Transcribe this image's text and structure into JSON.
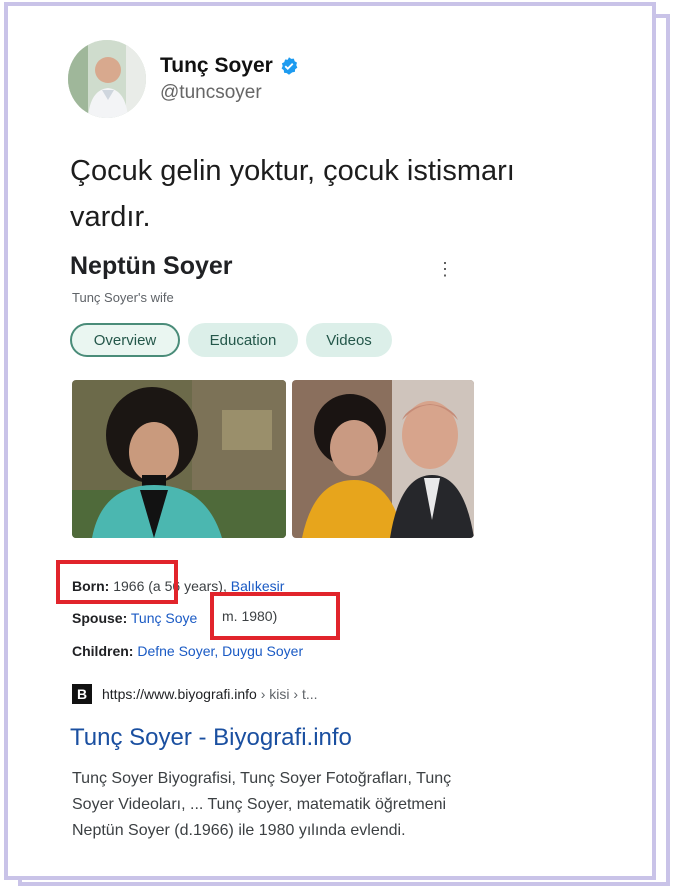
{
  "profile": {
    "name": "Tunç Soyer",
    "handle": "@tuncsoyer",
    "verified_icon": "verified-badge-icon",
    "verified_color": "#1d9bf0"
  },
  "tweet": {
    "line1": "Çocuk gelin yoktur, çocuk istismarı",
    "line2": "vardır."
  },
  "knowledge_panel": {
    "title": "Neptün Soyer",
    "subtitle": "Tunç Soyer's wife",
    "more_icon": "more-vert-icon",
    "tabs": [
      {
        "label": "Overview",
        "active": true
      },
      {
        "label": "Education",
        "active": false
      },
      {
        "label": "Videos",
        "active": false
      }
    ],
    "facts": {
      "born_label": "Born:",
      "born_value": "1966",
      "born_rest": " (a",
      "born_rest2": " 56 years),",
      "born_place": "Balıkesir",
      "spouse_label": "Spouse:",
      "spouse_value": "Tunç Soye",
      "spouse_rest": "m. 1980)",
      "children_label": "Children:",
      "children_value": "Defne Soyer, Duygu Soyer"
    },
    "highlight_color": "#e1242b"
  },
  "result": {
    "source_badge": "B",
    "url": "https://www.biyografi.info",
    "crumb": " › kisi › t...",
    "title": "Tunç Soyer - Biyografi.info",
    "snippet_l1": "Tunç Soyer Biyografisi, Tunç Soyer Fotoğrafları, Tunç",
    "snippet_l2": "Soyer Videoları, ... Tunç Soyer, matematik öğretmeni",
    "snippet_l3": "Neptün Soyer (d.1966) ile 1980 yılında evlendi."
  },
  "frame_color": "#c9c3e8"
}
